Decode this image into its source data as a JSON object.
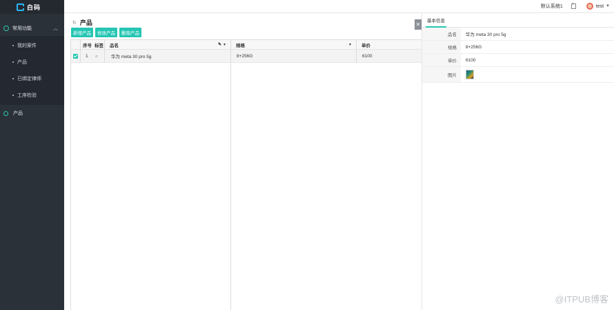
{
  "app": {
    "logo_text": "白码"
  },
  "sidebar": {
    "group_label": "常用功能",
    "subitems": [
      {
        "label": "我的案件"
      },
      {
        "label": "产品"
      },
      {
        "label": "已绑定律师"
      },
      {
        "label": "工序检验"
      }
    ],
    "top_item": {
      "label": "产品"
    }
  },
  "topbar": {
    "system": "默认系统1",
    "user": "test"
  },
  "page": {
    "title": "产品",
    "buttons": {
      "add": "新增产品",
      "edit": "修改产品",
      "delete": "删除产品"
    }
  },
  "table": {
    "columns": {
      "index": "序号",
      "tag": "标签",
      "name": "品名",
      "spec": "规格",
      "price": "单价"
    },
    "rows": [
      {
        "index": "1",
        "name": "华为 meta 30 pro 5g",
        "spec": "8+256G",
        "price": "6100",
        "selected": true
      }
    ]
  },
  "panel": {
    "tab": "基本信息",
    "fields": [
      {
        "label": "品名",
        "value": "华为 meta 30 pro 5g"
      },
      {
        "label": "规格",
        "value": "8+256G"
      },
      {
        "label": "单价",
        "value": "6100"
      },
      {
        "label": "图片",
        "value": ""
      }
    ]
  },
  "watermark": "@ITPUB博客",
  "colors": {
    "accent": "#26c6b3",
    "sidebar": "#2b3139"
  }
}
